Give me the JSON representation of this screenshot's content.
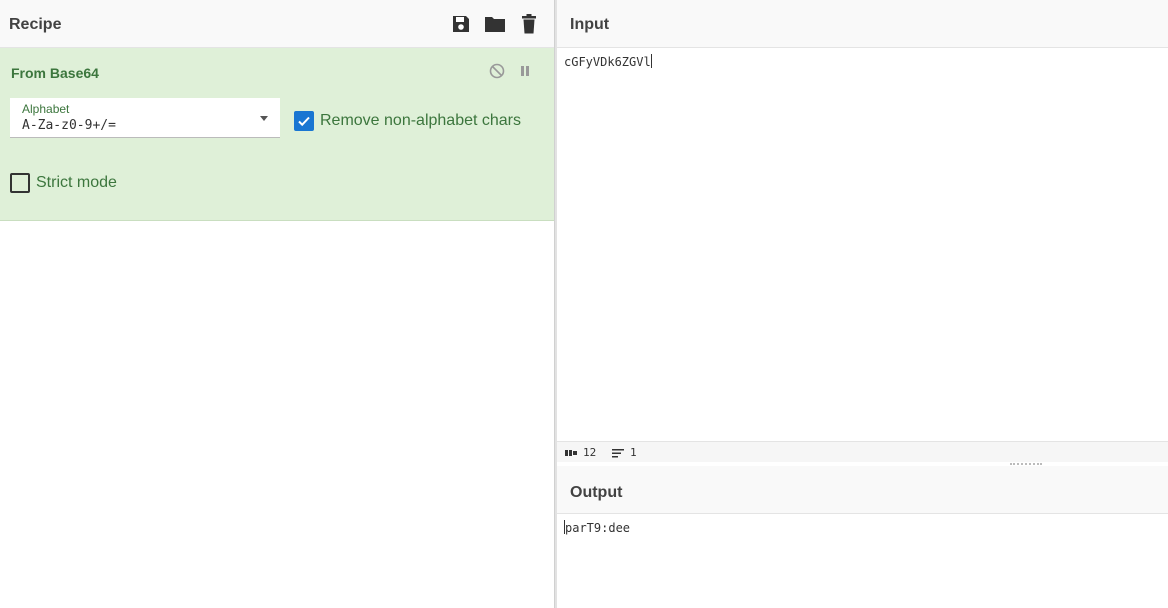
{
  "recipe": {
    "title": "Recipe",
    "icons": [
      "save-icon",
      "folder-icon",
      "trash-icon"
    ],
    "operation": {
      "name": "From Base64",
      "alphabet_label": "Alphabet",
      "alphabet_value": "A-Za-z0-9+/=",
      "remove_non_alphabet": {
        "label": "Remove non-alphabet chars",
        "checked": true
      },
      "strict_mode": {
        "label": "Strict mode",
        "checked": false
      }
    }
  },
  "input": {
    "title": "Input",
    "text": "cGFyVDk6ZGVl",
    "status": {
      "length": "12",
      "lines": "1"
    }
  },
  "output": {
    "title": "Output",
    "text": "parT9:dee"
  },
  "colors": {
    "op_bg": "#dff0d8",
    "op_text": "#3c763d",
    "checkbox_blue": "#1976d2"
  }
}
